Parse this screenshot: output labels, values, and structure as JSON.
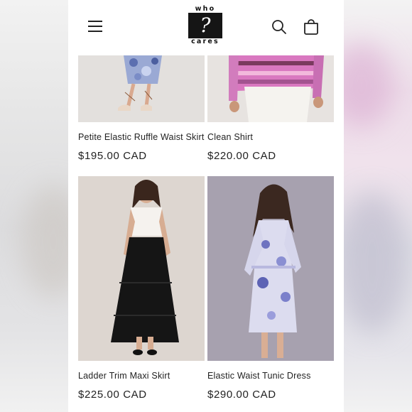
{
  "brand": {
    "logo_top": "who",
    "logo_mark": "?",
    "logo_bottom": "cares"
  },
  "header": {
    "menu_icon": "hamburger-menu-icon",
    "search_icon": "search-icon",
    "cart_icon": "shopping-bag-icon"
  },
  "products": [
    {
      "title": "Petite Elastic Ruffle Waist Skirt",
      "price": "$195.00 CAD"
    },
    {
      "title": "Clean Shirt",
      "price": "$220.00 CAD"
    },
    {
      "title": "Ladder Trim Maxi Skirt",
      "price": "$225.00 CAD"
    },
    {
      "title": "Elastic Waist Tunic Dress",
      "price": "$290.00 CAD"
    }
  ],
  "colors": {
    "text": "#222222",
    "background": "#ffffff",
    "photo_backdrop": "#ded7d2",
    "photo_backdrop_dress": "#a49ead"
  }
}
